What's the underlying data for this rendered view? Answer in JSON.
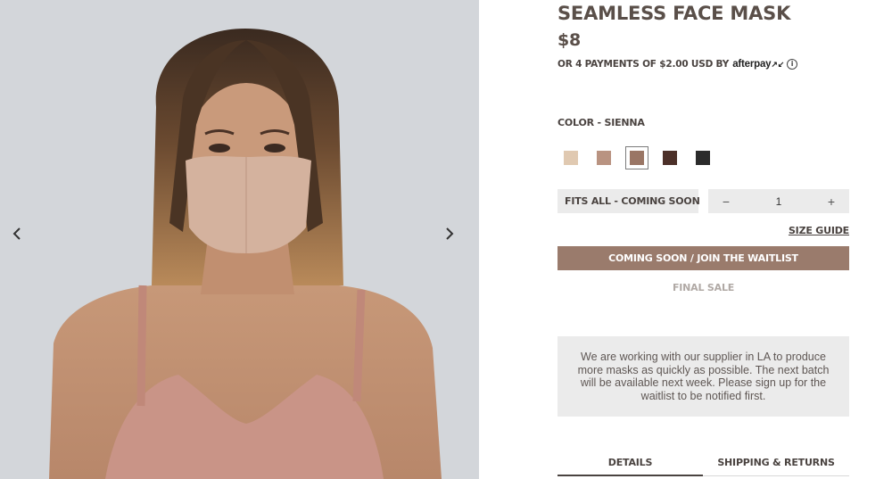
{
  "product": {
    "title": "SEAMLESS FACE MASK",
    "price": "$8",
    "installments_text": "OR 4 PAYMENTS OF $2.00 USD BY",
    "afterpay_brand": "afterpay",
    "afterpay_mark": "↗↙",
    "info_glyph": "i"
  },
  "color": {
    "label": "COLOR - SIENNA",
    "swatches": [
      {
        "name": "sand",
        "hex": "#e0c9b1",
        "selected": false
      },
      {
        "name": "clay",
        "hex": "#b99381",
        "selected": false
      },
      {
        "name": "sienna",
        "hex": "#9a7665",
        "selected": true
      },
      {
        "name": "cocoa",
        "hex": "#4c3029",
        "selected": false
      },
      {
        "name": "onyx",
        "hex": "#2b2b2b",
        "selected": false
      }
    ]
  },
  "size": {
    "selected": "FITS ALL - COMING SOON",
    "chevron": "chevron-down-icon"
  },
  "quantity": {
    "minus": "−",
    "value": "1",
    "plus": "+"
  },
  "links": {
    "size_guide": "SIZE GUIDE"
  },
  "actions": {
    "waitlist_label": "COMING SOON / JOIN THE WAITLIST",
    "final_sale": "FINAL SALE"
  },
  "notice": {
    "text": "We are working with our supplier in LA to produce more masks as quickly as possible. The next batch will be available next week. Please sign up for the waitlist to be notified first."
  },
  "tabs": [
    {
      "label": "DETAILS",
      "active": true
    },
    {
      "label": "SHIPPING & RETURNS",
      "active": false
    }
  ],
  "gallery": {
    "prev_icon": "chevron-left-icon",
    "next_icon": "chevron-right-icon"
  },
  "colors": {
    "accent": "#9a7b6c",
    "text": "#4a4340",
    "panel": "#ebebeb",
    "photo_bg": "#d3d6da"
  }
}
